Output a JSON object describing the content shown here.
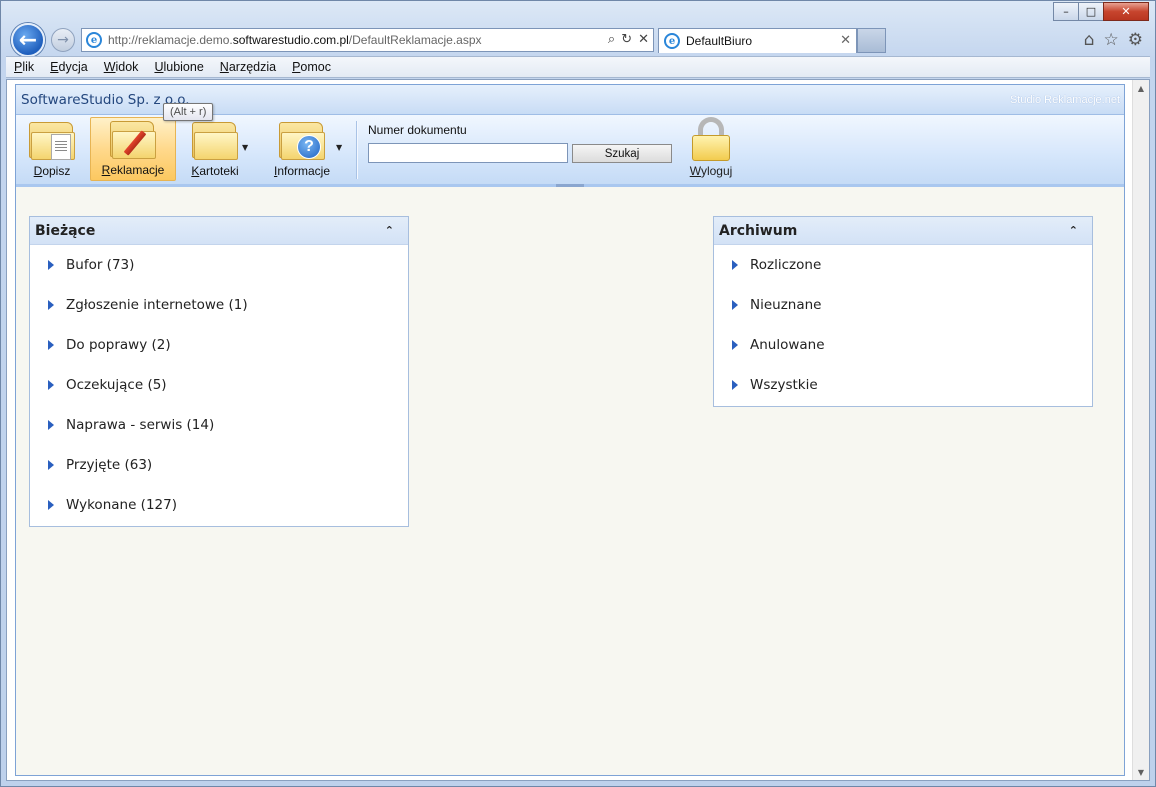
{
  "browser": {
    "url_prefix": "http://reklamacje.demo.",
    "url_domain": "softwarestudio.com.pl",
    "url_path": "/DefaultReklamacje.aspx",
    "tab_title": "DefaultBiuro",
    "menu": [
      "Plik",
      "Edycja",
      "Widok",
      "Ulubione",
      "Narzędzia",
      "Pomoc"
    ]
  },
  "app": {
    "company": "SoftwareStudio Sp. z o.o.",
    "brand": "Studio Reklamacje.net",
    "ribbon": {
      "dopisz": "Dopisz",
      "reklamacje": "Reklamacje",
      "kartoteki": "Kartoteki",
      "informacje": "Informacje",
      "search_label": "Numer dokumentu",
      "search_value": "",
      "search_button": "Szukaj",
      "logout": "Wyloguj",
      "tooltip": "(Alt + r)"
    },
    "panels": {
      "biezace": {
        "title": "Bieżące",
        "items": [
          "Bufor (73)",
          "Zgłoszenie internetowe (1)",
          "Do poprawy (2)",
          "Oczekujące (5)",
          "Naprawa - serwis (14)",
          "Przyjęte (63)",
          "Wykonane (127)"
        ]
      },
      "archiwum": {
        "title": "Archiwum",
        "items": [
          "Rozliczone",
          "Nieuznane",
          "Anulowane",
          "Wszystkie"
        ]
      }
    }
  },
  "icons": {
    "back": "←",
    "forward": "→",
    "search": "⌕",
    "refresh": "↻",
    "stop": "✕",
    "home": "⌂",
    "favorites": "☆",
    "tools": "⚙",
    "collapse": "⌃",
    "minimize": "–",
    "maximize": "□",
    "close": "✕"
  }
}
